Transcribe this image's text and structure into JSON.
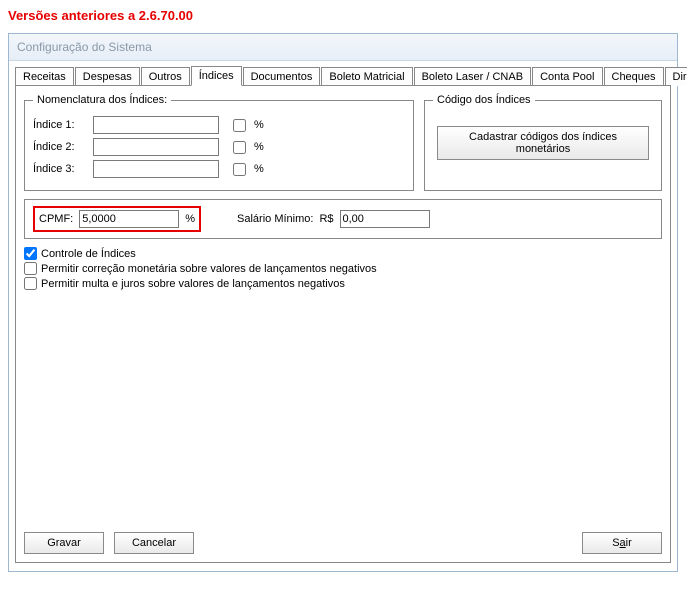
{
  "version_header": "Versões anteriores a 2.6.70.00",
  "window_title": "Configuração do Sistema",
  "tabs": [
    {
      "label": "Receitas"
    },
    {
      "label": "Despesas"
    },
    {
      "label": "Outros"
    },
    {
      "label": "Índices",
      "active": true
    },
    {
      "label": "Documentos"
    },
    {
      "label": "Boleto Matricial"
    },
    {
      "label": "Boleto Laser / CNAB"
    },
    {
      "label": "Conta Pool"
    },
    {
      "label": "Cheques"
    },
    {
      "label": "Diretórios"
    }
  ],
  "nomenclatura": {
    "legend": "Nomenclatura dos Índices:",
    "rows": [
      {
        "label": "Índice 1:",
        "value": "",
        "pct_checked": false,
        "pct_label": "%"
      },
      {
        "label": "Índice 2:",
        "value": "",
        "pct_checked": false,
        "pct_label": "%"
      },
      {
        "label": "Índice 3:",
        "value": "",
        "pct_checked": false,
        "pct_label": "%"
      }
    ]
  },
  "codigo": {
    "legend": "Código dos Índices",
    "button": "Cadastrar códigos dos índices monetários"
  },
  "cpmf": {
    "label": "CPMF:",
    "value": "5,0000",
    "suffix": "%"
  },
  "salario_minimo": {
    "label": "Salário Mínimo:",
    "currency": "R$",
    "value": "0,00"
  },
  "options": {
    "controle": {
      "label": "Controle de Índices",
      "checked": true
    },
    "permitir_correcao": {
      "label": "Permitir correção monetária sobre valores de lançamentos negativos",
      "checked": false
    },
    "permitir_multa": {
      "label": "Permitir multa e juros sobre valores de lançamentos negativos",
      "checked": false
    }
  },
  "buttons": {
    "gravar": "Gravar",
    "cancelar": "Cancelar",
    "sair_pre": "S",
    "sair_key": "a",
    "sair_post": "ir"
  }
}
